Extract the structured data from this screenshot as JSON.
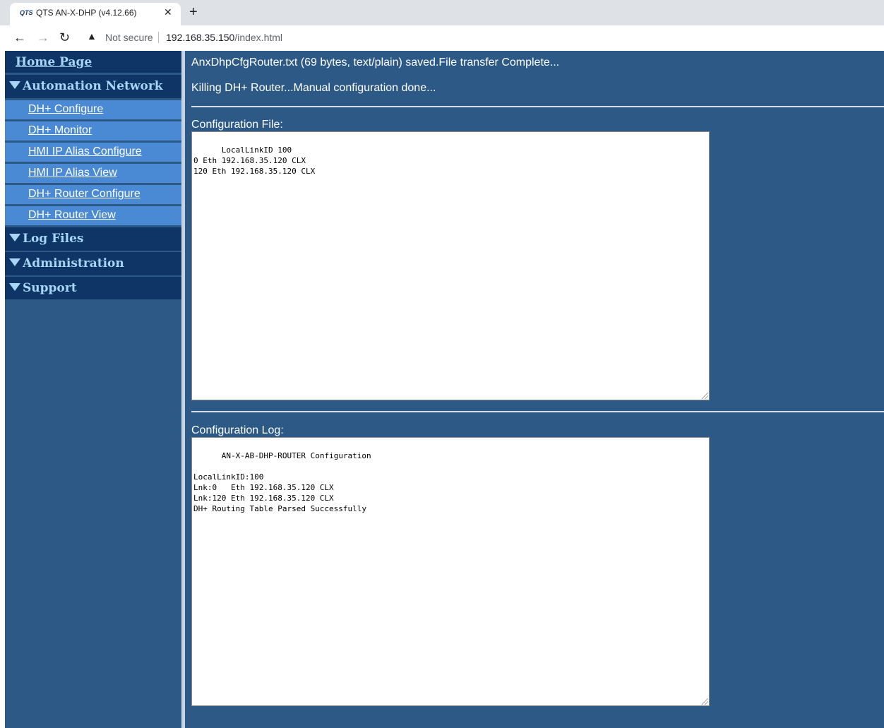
{
  "browser": {
    "tab_favicon": "QTS",
    "tab_title": "QTS AN-X-DHP (v4.12.66)",
    "close_glyph": "✕",
    "new_tab_glyph": "+",
    "back_glyph": "←",
    "forward_glyph": "→",
    "reload_glyph": "↻",
    "warning_glyph": "▲",
    "security_label": "Not secure",
    "url_host": "192.168.35.150",
    "url_path": "/index.html"
  },
  "sidebar": {
    "home": "Home Page",
    "sections": [
      {
        "label": "Automation Network"
      },
      {
        "label": "Log Files"
      },
      {
        "label": "Administration"
      },
      {
        "label": "Support"
      }
    ],
    "automation_items": [
      {
        "label": "DH+ Configure"
      },
      {
        "label": "DH+ Monitor"
      },
      {
        "label": "HMI IP Alias Configure"
      },
      {
        "label": "HMI IP Alias View"
      },
      {
        "label": "DH+ Router Configure"
      },
      {
        "label": "DH+ Router View"
      }
    ]
  },
  "main": {
    "messages": [
      "AnxDhpCfgRouter.txt (69 bytes, text/plain) saved.File transfer Complete...",
      "Killing DH+ Router...Manual configuration done..."
    ],
    "config_file_label": "Configuration File:",
    "config_file_text": "LocalLinkID 100\n0 Eth 192.168.35.120 CLX\n120 Eth 192.168.35.120 CLX",
    "config_log_label": "Configuration Log:",
    "config_log_text": "AN-X-AB-DHP-ROUTER Configuration\n\nLocalLinkID:100\nLnk:0   Eth 192.168.35.120 CLX\nLnk:120 Eth 192.168.35.120 CLX\nDH+ Routing Table Parsed Successfully"
  },
  "colors": {
    "page_bg": "#2d5987",
    "section_header_bg": "#0e3566",
    "section_header_text": "#a8d5f5",
    "submenu_bg": "#4a89d4"
  }
}
